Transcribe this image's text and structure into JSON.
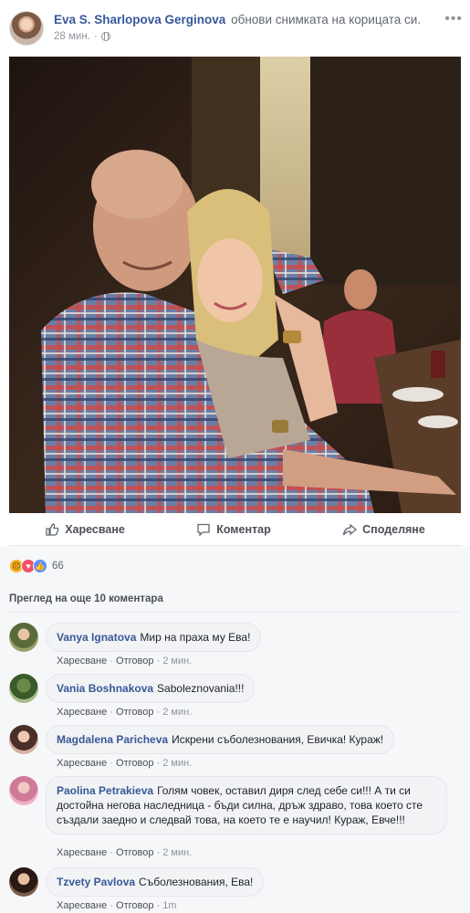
{
  "post": {
    "author": "Eva S. Sharlopova Gerginova",
    "action_text": "обнови снимката на корицата си.",
    "time": "28 мин.",
    "more_icon": "ellipsis-icon",
    "privacy_icon": "globe-icon"
  },
  "actions": {
    "like": "Харесване",
    "comment": "Коментар",
    "share": "Споделяне"
  },
  "reactions": {
    "types": [
      "sad",
      "love",
      "like"
    ],
    "count": "66"
  },
  "more_comments": "Преглед на още 10 коментара",
  "comments": [
    {
      "author": "Vanya Ignatova",
      "text": "Мир на праха му Ева!",
      "like": "Харесване",
      "reply": "Отговор",
      "time": "2 мин."
    },
    {
      "author": "Vania Boshnakova",
      "text": "Saboleznovania!!!",
      "like": "Харесване",
      "reply": "Отговор",
      "time": "2 мин."
    },
    {
      "author": "Magdalena Paricheva",
      "text": "Искрени съболезнования, Евичка! Кураж!",
      "like": "Харесване",
      "reply": "Отговор",
      "time": "2 мин."
    },
    {
      "author": "Paolina Petrakieva",
      "text": "Голям човек, оставил диря след себе си!!! А ти си достойна негова наследница - бъди силна, дръж здраво, това което сте създали заедно и следвай това, на което те е научил! Кураж, Евче!!!",
      "like": "Харесване",
      "reply": "Отговор",
      "time": "2 мин."
    },
    {
      "author": "Tzvety Pavlova",
      "text": "Съболезнования, Ева!",
      "like": "Харесване",
      "reply": "Отговор",
      "time": "1m"
    }
  ],
  "colors": {
    "link": "#365899",
    "meta": "#90949c",
    "like": "#5890ff",
    "love": "#f25268",
    "sad": "#f7b125"
  }
}
